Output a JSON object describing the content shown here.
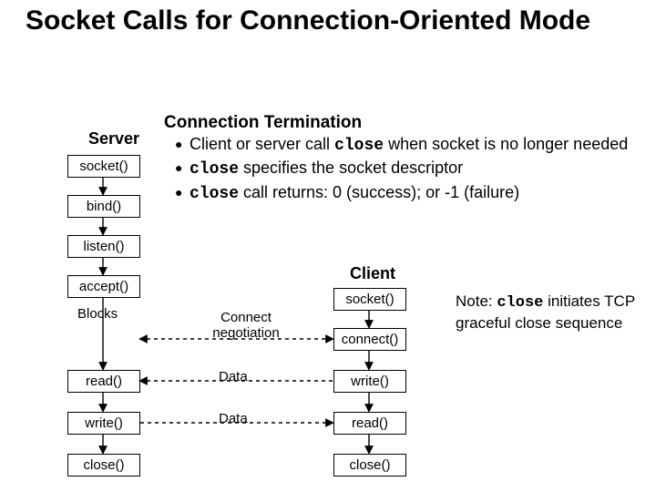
{
  "title": "Socket Calls for Connection-Oriented Mode",
  "section_heading": "Connection Termination",
  "bullets": {
    "b1_pre": "Client or server call ",
    "b1_code": "close",
    "b1_post": " when socket is no longer needed",
    "b2_code": "close",
    "b2_post": " specifies the socket descriptor",
    "b3_code": "close",
    "b3_post": " call returns: 0 (success); or -1 (failure)"
  },
  "server": {
    "label": "Server",
    "socket": "socket()",
    "bind": "bind()",
    "listen": "listen()",
    "accept": "accept()",
    "blocks": "Blocks",
    "read": "read()",
    "write": "write()",
    "close": "close()"
  },
  "client": {
    "label": "Client",
    "socket": "socket()",
    "connect": "connect()",
    "write": "write()",
    "read": "read()",
    "close": "close()"
  },
  "mid": {
    "connect_neg": "Connect negotiation",
    "data1": "Data",
    "data2": "Data"
  },
  "note": {
    "pre": "Note: ",
    "code": "close",
    "post": " initiates TCP graceful close sequence"
  }
}
